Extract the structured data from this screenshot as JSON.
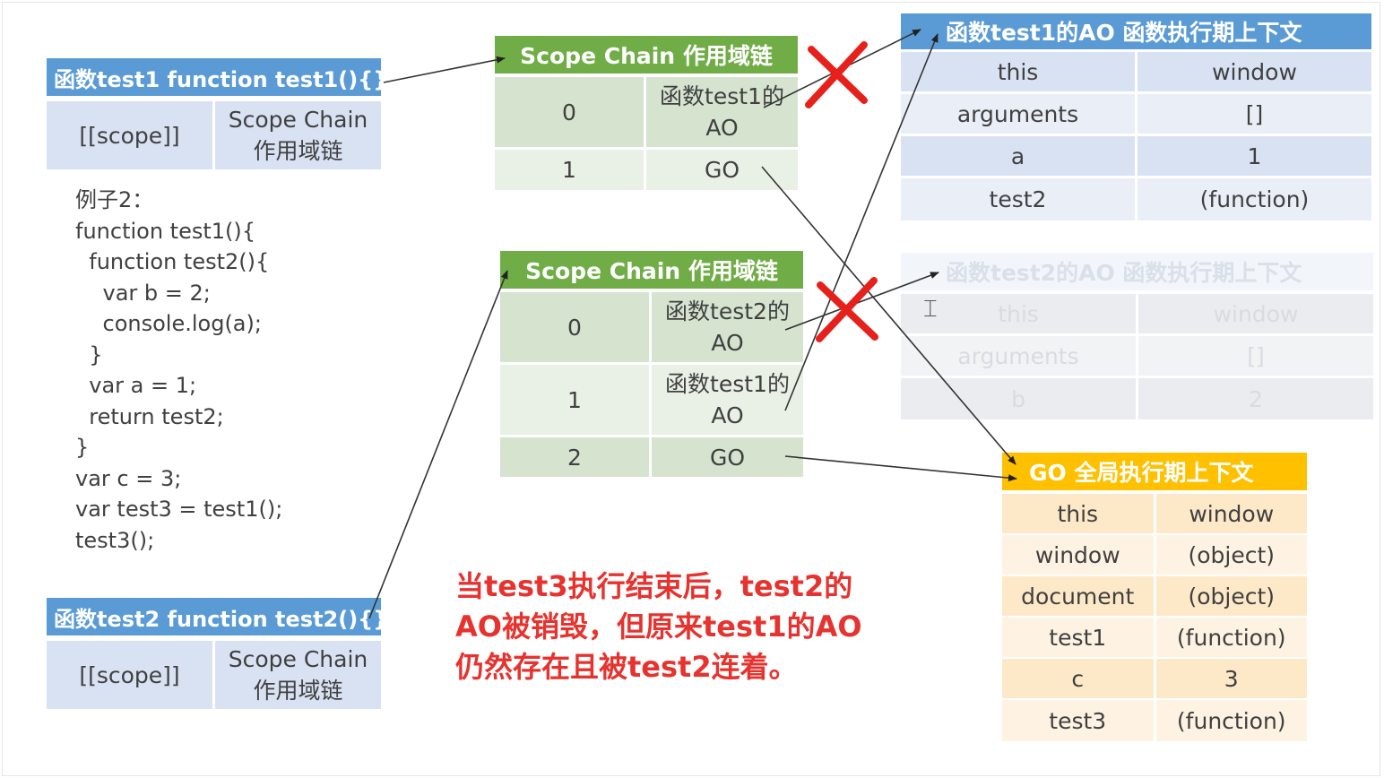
{
  "fn_test1": {
    "header": "函数test1  function test1(){}",
    "scope_key": "[[scope]]",
    "scope_value_line1": "Scope Chain",
    "scope_value_line2": "作用域链"
  },
  "fn_test2": {
    "header": "函数test2  function test2(){}",
    "scope_key": "[[scope]]",
    "scope_value_line1": "Scope Chain",
    "scope_value_line2": "作用域链"
  },
  "code": {
    "lines": [
      "例子2：",
      "function test1(){",
      "  function test2(){",
      "    var b = 2;",
      "    console.log(a);",
      "  }",
      "  var a = 1;",
      "  return test2;",
      "}",
      "var c = 3;",
      "var test3 = test1();",
      "test3();"
    ]
  },
  "scope_chain_1": {
    "title": "Scope Chain 作用域链",
    "rows": [
      {
        "index": "0",
        "line1": "函数test1的",
        "line2": "AO"
      },
      {
        "index": "1",
        "line1": "GO",
        "line2": ""
      }
    ]
  },
  "scope_chain_2": {
    "title": "Scope Chain 作用域链",
    "rows": [
      {
        "index": "0",
        "line1": "函数test2的",
        "line2": "AO"
      },
      {
        "index": "1",
        "line1": "函数test1的",
        "line2": "AO"
      },
      {
        "index": "2",
        "line1": "GO",
        "line2": ""
      }
    ]
  },
  "ao_test1": {
    "title": "函数test1的AO 函数执行期上下文",
    "rows": [
      {
        "key": "this",
        "value": "window"
      },
      {
        "key": "arguments",
        "value": "[]"
      },
      {
        "key": "a",
        "value": "1"
      },
      {
        "key": "test2",
        "value": "(function)"
      }
    ]
  },
  "ao_test2": {
    "title": "函数test2的AO 函数执行期上下文",
    "rows": [
      {
        "key": "this",
        "value": "window"
      },
      {
        "key": "arguments",
        "value": "[]"
      },
      {
        "key": "b",
        "value": "2"
      }
    ]
  },
  "go": {
    "title": "GO 全局执行期上下文",
    "rows": [
      {
        "key": "this",
        "value": "window"
      },
      {
        "key": "window",
        "value": "(object)"
      },
      {
        "key": "document",
        "value": "(object)"
      },
      {
        "key": "test1",
        "value": "(function)"
      },
      {
        "key": "c",
        "value": "3"
      },
      {
        "key": "test3",
        "value": "(function)"
      }
    ]
  },
  "note": {
    "line1": "当test3执行结束后，test2的",
    "line2": "AO被销毁，但原来test1的AO",
    "line3": "仍然存在且被test2连着。"
  },
  "colors": {
    "blue": "#5b9bd5",
    "green": "#70ad47",
    "gold": "#ffc000",
    "red": "#e7332f"
  },
  "icons": [
    "red-x-cross-icon",
    "text-cursor-icon"
  ]
}
